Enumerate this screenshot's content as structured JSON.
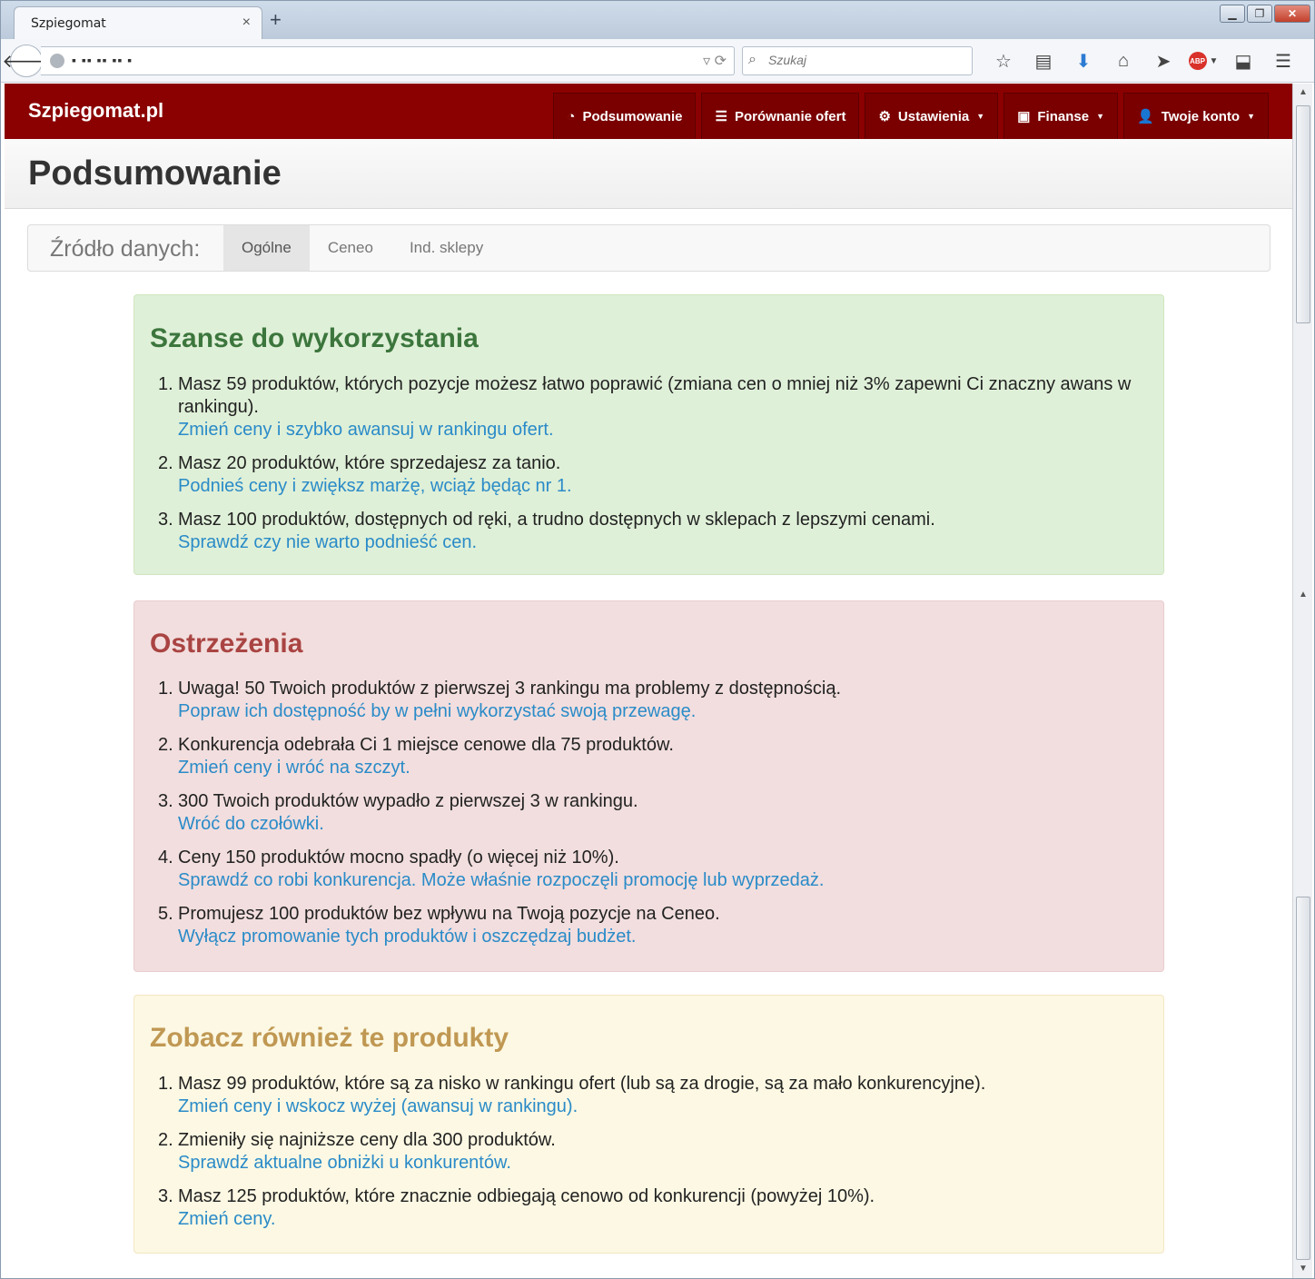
{
  "browser": {
    "tab_title": "Szpiegomat",
    "tab_close": "×",
    "new_tab": "+",
    "url_text": "▪ ▪▪ ▪▪ ▪▪ ▪",
    "search_placeholder": "Szukaj"
  },
  "site": {
    "brand": "Szpiegomat.pl",
    "menu": [
      {
        "label": "Podsumowanie",
        "icon": "dashboard-icon"
      },
      {
        "label": "Porównanie ofert",
        "icon": "list-icon"
      },
      {
        "label": "Ustawienia",
        "icon": "gear-icon"
      },
      {
        "label": "Finanse",
        "icon": "money-icon"
      },
      {
        "label": "Twoje konto",
        "icon": "user-icon"
      }
    ]
  },
  "page": {
    "title": "Podsumowanie",
    "source_label": "Źródło danych:",
    "source_tabs": [
      "Ogólne",
      "Ceneo",
      "Ind. sklepy"
    ],
    "active_source_tab": "Ogólne"
  },
  "panels": {
    "opportunities": {
      "title": "Szanse do wykorzystania",
      "items": [
        {
          "num": "1.",
          "text": "Masz 59 produktów, których pozycje możesz łatwo poprawić (zmiana cen o mniej niż 3% zapewni Ci znaczny awans w rankingu).",
          "link": "Zmień ceny i szybko awansuj w rankingu ofert."
        },
        {
          "num": "2.",
          "text": "Masz 20 produktów, które sprzedajesz za tanio.",
          "link": "Podnieś ceny i zwiększ marżę, wciąż będąc nr 1."
        },
        {
          "num": "3.",
          "text": "Masz 100 produktów, dostępnych od ręki, a trudno dostępnych w sklepach z lepszymi cenami.",
          "link": "Sprawdź czy nie warto podnieść cen."
        }
      ]
    },
    "warnings": {
      "title": "Ostrzeżenia",
      "items": [
        {
          "num": "1.",
          "text": "Uwaga! 50 Twoich produktów z pierwszej 3 rankingu ma problemy z dostępnością.",
          "link": "Popraw ich dostępność by w pełni wykorzystać swoją przewagę."
        },
        {
          "num": "2.",
          "text": "Konkurencja odebrała Ci 1 miejsce cenowe dla 75 produktów.",
          "link": "Zmień ceny i wróć na szczyt."
        },
        {
          "num": "3.",
          "text": "300 Twoich produktów wypadło z pierwszej 3 w rankingu.",
          "link": "Wróć do czołówki."
        },
        {
          "num": "4.",
          "text": "Ceny 150 produktów mocno spadły (o więcej niż 10%).",
          "link": "Sprawdź co robi konkurencja. Może właśnie rozpoczęli promocję lub wyprzedaż."
        },
        {
          "num": "5.",
          "text": "Promujesz 100 produktów bez wpływu na Twoją pozycje na Ceneo.",
          "link": "Wyłącz promowanie tych produktów i oszczędzaj budżet."
        }
      ]
    },
    "see_also": {
      "title": "Zobacz również te produkty",
      "items": [
        {
          "num": "1.",
          "text": "Masz 99 produktów, które są za nisko w rankingu ofert (lub są za drogie, są za mało konkurencyjne).",
          "link": "Zmień ceny i wskocz wyżej (awansuj w rankingu)."
        },
        {
          "num": "2.",
          "text": "Zmieniły się najniższe ceny dla 300 produktów.",
          "link": "Sprawdź aktualne obniżki u konkurentów."
        },
        {
          "num": "3.",
          "text": "Masz 125 produktów, które znacznie odbiegają cenowo od konkurencji (powyżej 10%).",
          "link": "Zmień ceny."
        }
      ]
    }
  },
  "colors": {
    "navbar": "#8b0000",
    "success_bg": "#dff0d8",
    "success_title": "#3c763d",
    "danger_bg": "#f2dede",
    "danger_title": "#a94442",
    "warning_bg": "#fcf8e3",
    "warning_title": "#c09853",
    "link": "#2a8bc8"
  }
}
